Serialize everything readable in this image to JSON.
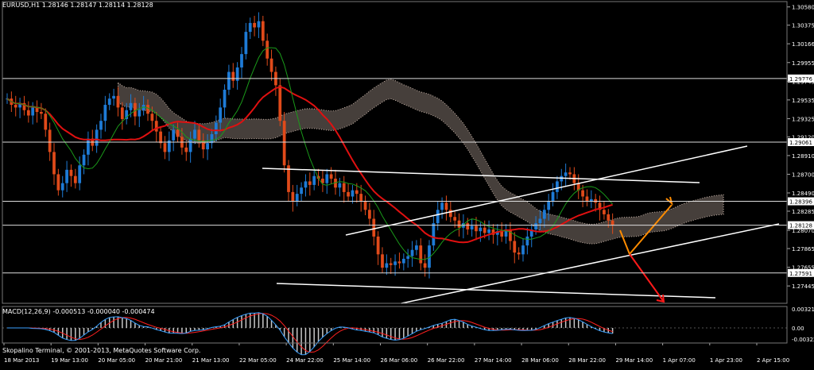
{
  "header": {
    "symbol": "EURUSD,H1",
    "ohlc": "1.28146 1.28147 1.28114 1.28128"
  },
  "indicator": {
    "label": "MACD(12,26,9)",
    "values": "-0.000513 -0.000040 -0.000474",
    "scale_labels": [
      "0.003211",
      "0.00",
      "-0.003223"
    ]
  },
  "copyright": "Skopalino Terminal, © 2001-2013, MetaQuotes Software Corp.",
  "colors": {
    "background": "#000000",
    "bull": "#1e7bd6",
    "bear": "#e04a1a",
    "ma_red": "#e01010",
    "ma_green": "#1a9a1a",
    "cloud": "#c8b4a8",
    "trend_white": "#ffffff",
    "arrow_orange": "#ff8c00",
    "arrow_red": "#ff1a1a",
    "macd_hist": "#c8c8c8",
    "macd_signal": "#ff2020",
    "macd_line": "#3aa0ff"
  },
  "chart_data": {
    "type": "candlestick",
    "symbol": "EURUSD",
    "timeframe": "H1",
    "ylim": [
      1.2725,
      1.3064
    ],
    "y_ticks": [
      "1.30580",
      "1.30375",
      "1.30166",
      "1.29955",
      "1.29745",
      "1.29535",
      "1.29325",
      "1.29120",
      "1.28910",
      "1.28700",
      "1.28490",
      "1.28285",
      "1.28070",
      "1.27865",
      "1.27655",
      "1.27445"
    ],
    "y_tick_values": [
      1.3058,
      1.30375,
      1.30166,
      1.29955,
      1.29745,
      1.29535,
      1.29325,
      1.2912,
      1.2891,
      1.287,
      1.2849,
      1.28285,
      1.2807,
      1.27865,
      1.27655,
      1.27445
    ],
    "highlight_levels": [
      {
        "label": "1.29776",
        "value": 1.29776
      },
      {
        "label": "1.29061",
        "value": 1.29061
      },
      {
        "label": "1.28396",
        "value": 1.28396
      },
      {
        "label": "1.28128",
        "value": 1.28128
      },
      {
        "label": "1.27591",
        "value": 1.27591
      }
    ],
    "x_labels": [
      "18 Mar 2013",
      "19 Mar 13:00",
      "20 Mar 05:00",
      "20 Mar 21:00",
      "21 Mar 13:00",
      "22 Mar 05:00",
      "24 Mar 22:00",
      "25 Mar 14:00",
      "26 Mar 06:00",
      "26 Mar 22:00",
      "27 Mar 14:00",
      "28 Mar 06:00",
      "28 Mar 22:00",
      "29 Mar 14:00",
      "1 Apr 07:00",
      "1 Apr 23:00",
      "2 Apr 15:00"
    ],
    "close_path": [
      1.2955,
      1.2948,
      1.2945,
      1.295,
      1.2942,
      1.2936,
      1.2945,
      1.294,
      1.2938,
      1.292,
      1.2895,
      1.287,
      1.2852,
      1.286,
      1.2875,
      1.2868,
      1.286,
      1.288,
      1.2892,
      1.291,
      1.2902,
      1.292,
      1.293,
      1.2948,
      1.2955,
      1.2958,
      1.2945,
      1.2932,
      1.2942,
      1.295,
      1.2935,
      1.2942,
      1.2948,
      1.2938,
      1.293,
      1.2918,
      1.2905,
      1.2895,
      1.2908,
      1.292,
      1.2912,
      1.29,
      1.2895,
      1.291,
      1.292,
      1.2908,
      1.2898,
      1.2905,
      1.2915,
      1.2928,
      1.2945,
      1.2965,
      1.2985,
      1.2975,
      1.299,
      1.3005,
      1.303,
      1.304,
      1.3035,
      1.3042,
      1.302,
      1.3,
      1.2985,
      1.297,
      1.293,
      1.288,
      1.285,
      1.284,
      1.2848,
      1.2855,
      1.2862,
      1.2858,
      1.2868,
      1.2865,
      1.286,
      1.287,
      1.2865,
      1.2855,
      1.286,
      1.285,
      1.2845,
      1.2852,
      1.2848,
      1.284,
      1.283,
      1.282,
      1.28,
      1.278,
      1.2765,
      1.277,
      1.2768,
      1.2772,
      1.277,
      1.2775,
      1.2778,
      1.2785,
      1.279,
      1.277,
      1.2765,
      1.279,
      1.2815,
      1.283,
      1.2838,
      1.283,
      1.2822,
      1.2818,
      1.281,
      1.2815,
      1.2808,
      1.2812,
      1.2806,
      1.281,
      1.2804,
      1.2808,
      1.2802,
      1.2806,
      1.28,
      1.2808,
      1.2795,
      1.2782,
      1.278,
      1.279,
      1.28,
      1.2808,
      1.2815,
      1.282,
      1.283,
      1.284,
      1.285,
      1.2862,
      1.2868,
      1.2872,
      1.287,
      1.286,
      1.2852,
      1.2845,
      1.284,
      1.2842,
      1.2838,
      1.283,
      1.2825,
      1.2818,
      1.2813
    ]
  }
}
